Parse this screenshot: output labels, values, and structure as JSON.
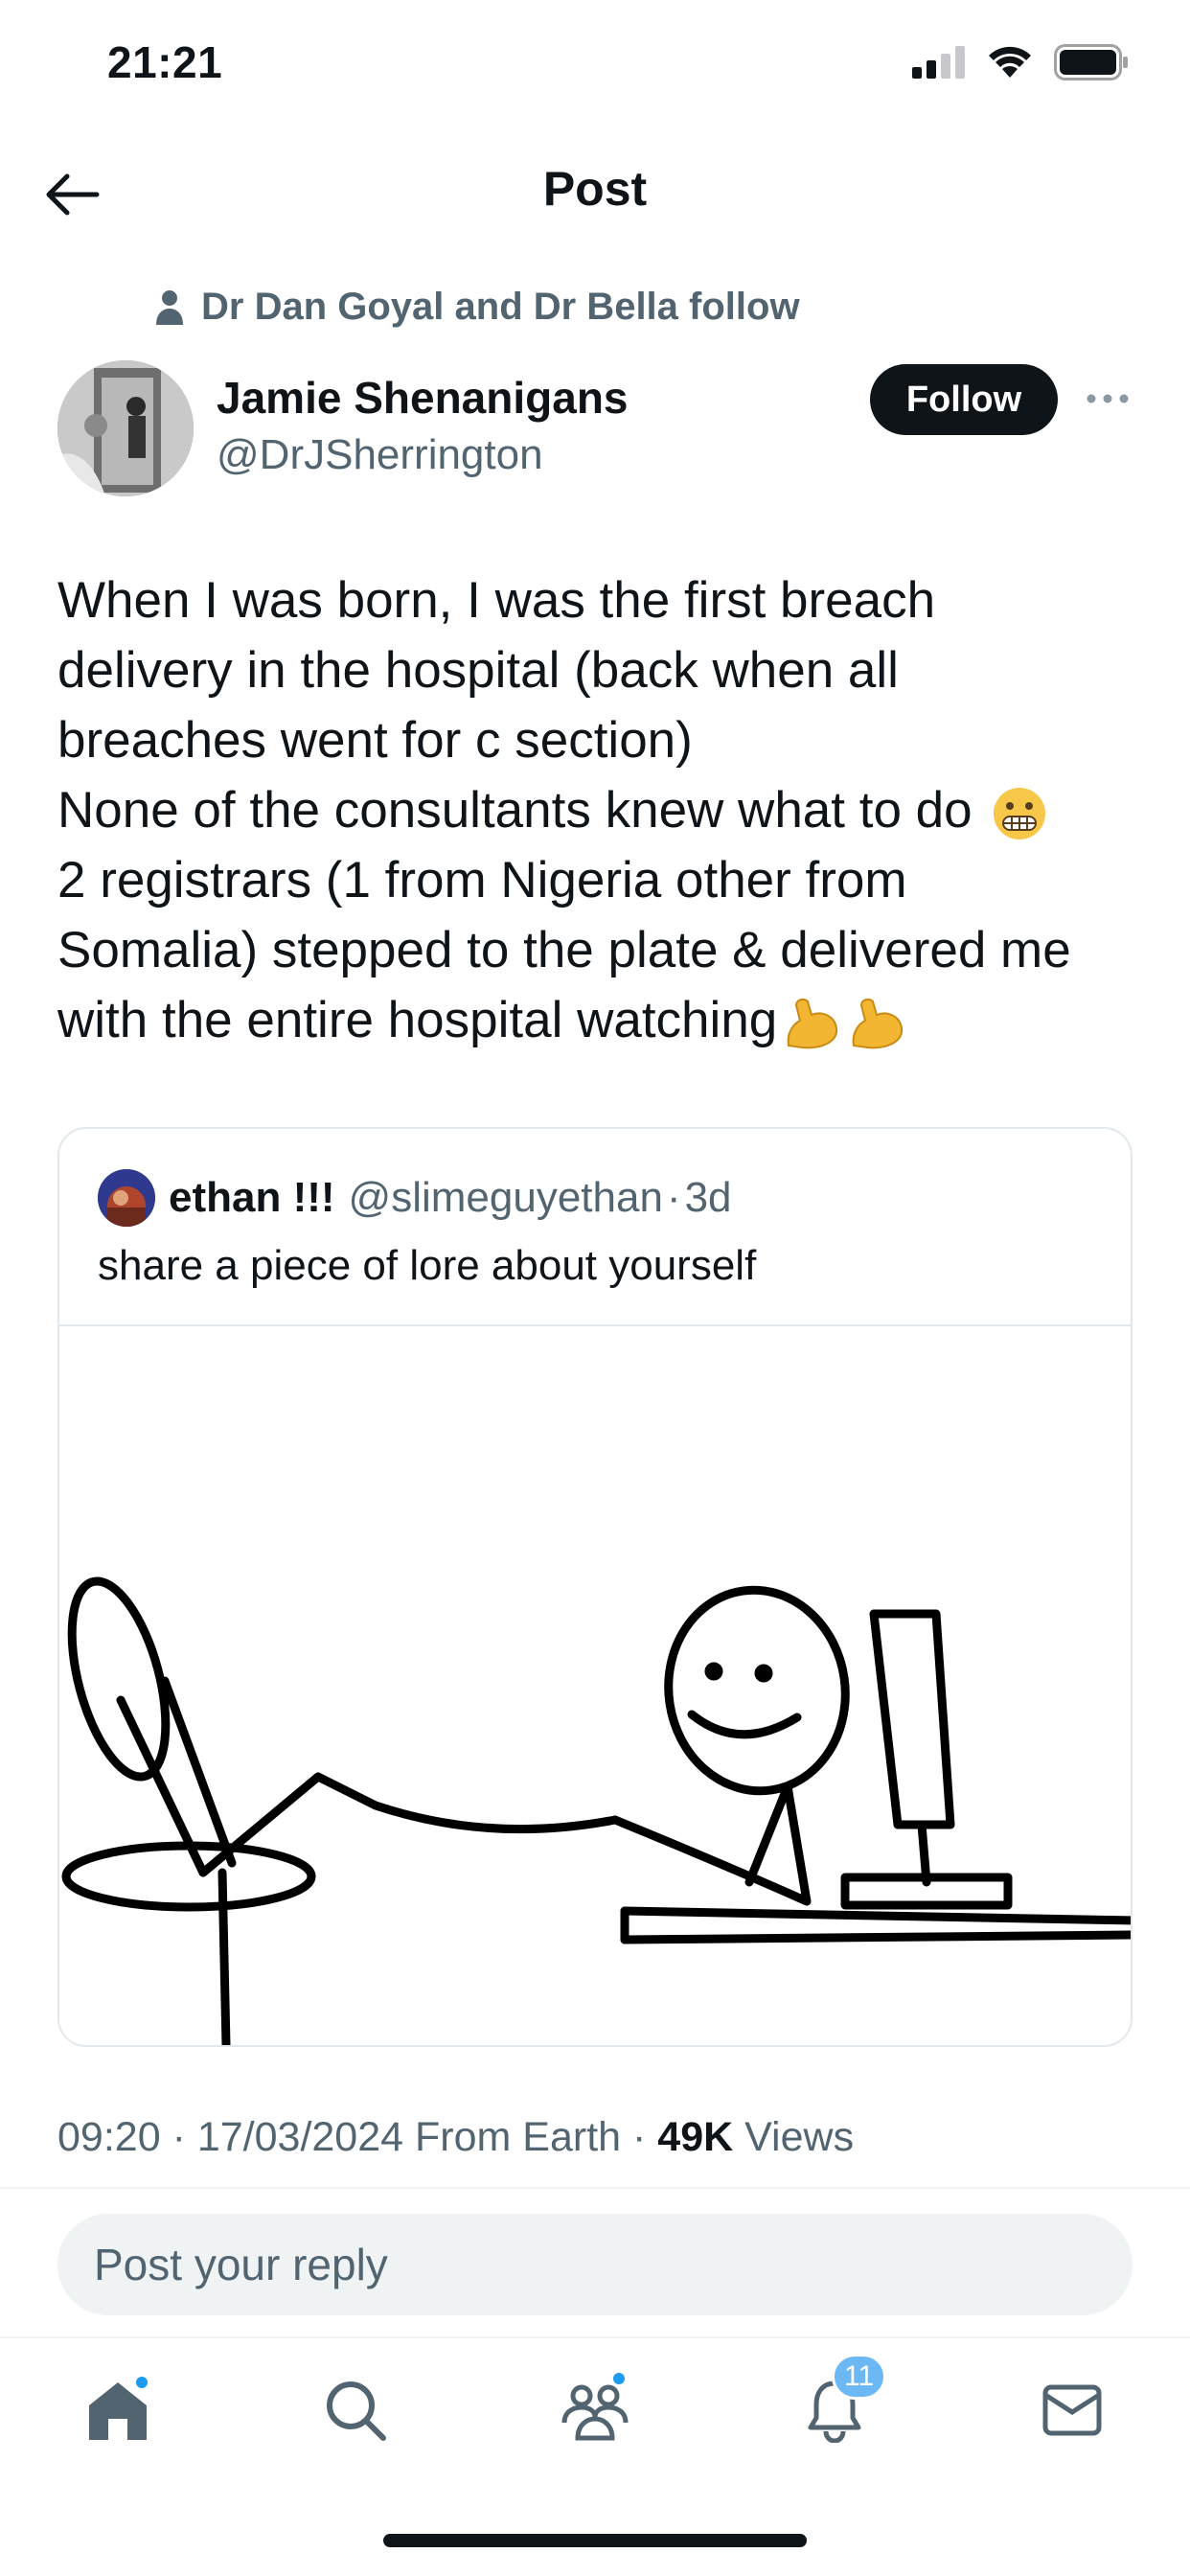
{
  "status_bar": {
    "time": "21:21"
  },
  "header": {
    "title": "Post"
  },
  "social_context": {
    "text": "Dr Dan Goyal and Dr Bella follow"
  },
  "author": {
    "name": "Jamie Shenanigans",
    "handle": "@DrJSherrington",
    "follow_label": "Follow"
  },
  "post": {
    "lines": [
      "When I was born, I was the first breach",
      "delivery in the hospital (back when all",
      "breaches went for c section)",
      "None of the consultants knew what to do",
      "2 registrars (1 from Nigeria other from",
      "Somalia) stepped to the plate & delivered me",
      "with the entire hospital watching"
    ],
    "emojis": {
      "grimace": "😬",
      "muscle": "💪"
    }
  },
  "quote": {
    "name": "ethan !!!",
    "handle": "@slimeguyethan",
    "separator": "·",
    "age": "3d",
    "text": "share a piece of lore about yourself"
  },
  "meta": {
    "time": "09:20",
    "sep1": "·",
    "date": "17/03/2024",
    "source": "From Earth",
    "sep2": "·",
    "views_count": "49K",
    "views_label": "Views"
  },
  "reply": {
    "placeholder": "Post your reply"
  },
  "tabs": {
    "notifications_badge": "11"
  },
  "colors": {
    "text": "#0f1419",
    "secondary": "#536471",
    "accent": "#1d9bf0",
    "follow_bg": "#0f1419"
  }
}
